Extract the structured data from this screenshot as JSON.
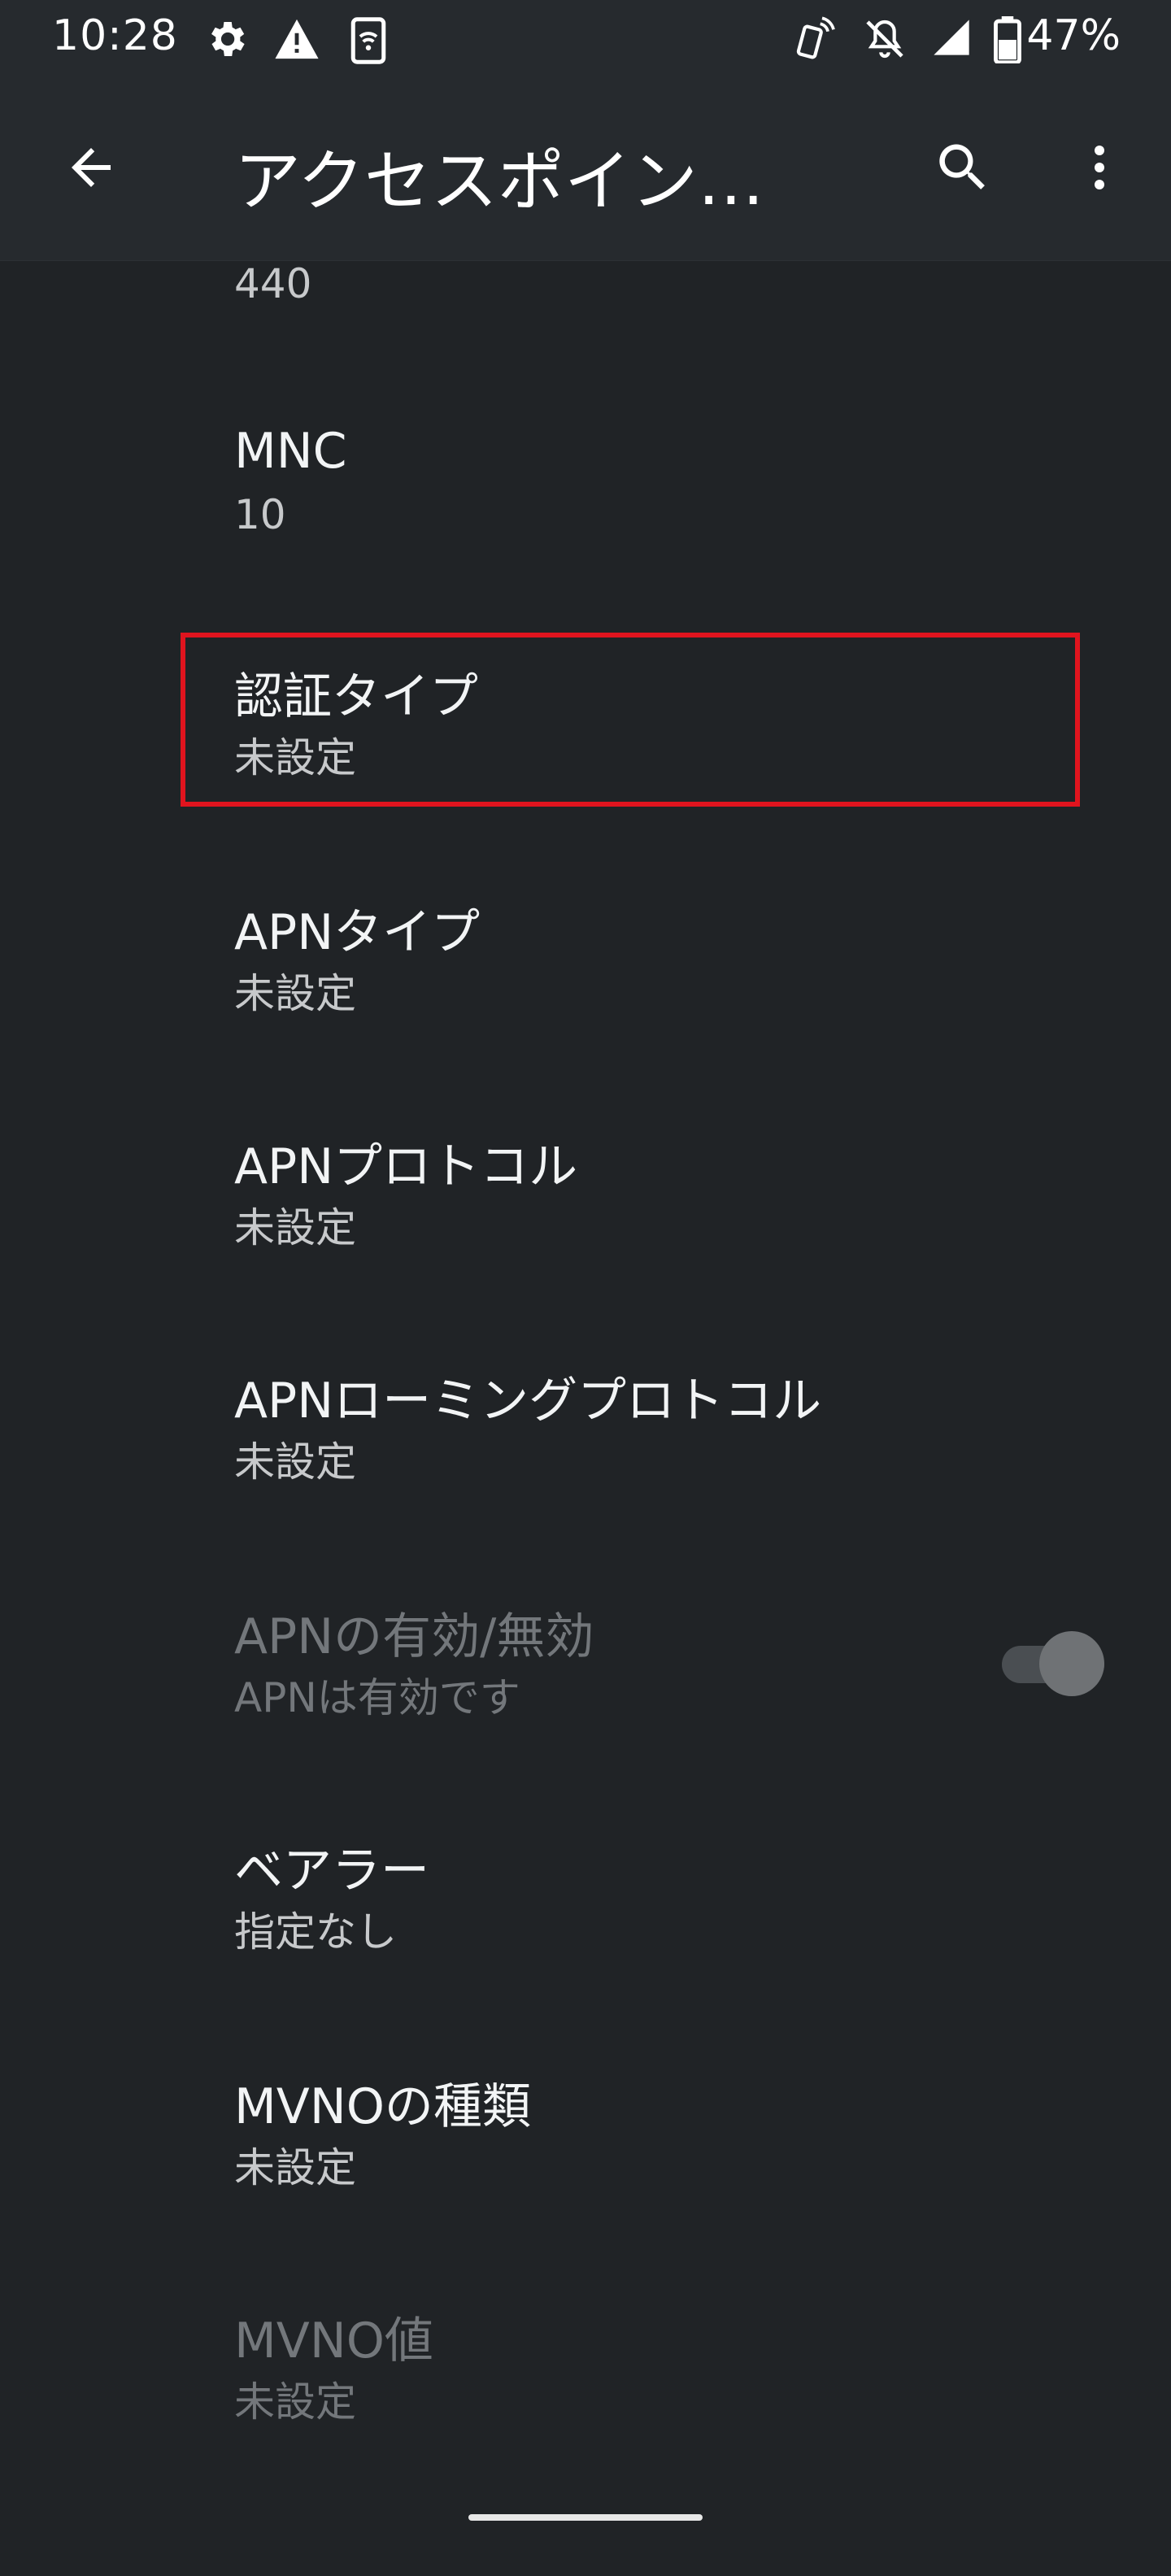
{
  "status_bar": {
    "time": "10:28",
    "icons": [
      "gear-icon",
      "warning-icon",
      "sim-wifi-icon",
      "nfc-phone-icon",
      "bell-off-icon",
      "signal-icon",
      "battery-icon"
    ],
    "battery": "47%"
  },
  "app_bar": {
    "title": "アクセスポイント…",
    "back_icon": "arrow-back-icon",
    "search_icon": "search-icon",
    "more_icon": "more-vert-icon"
  },
  "items": [
    {
      "title": "",
      "summary": "440"
    },
    {
      "title": "MNC",
      "summary": "10"
    },
    {
      "title": "認証タイプ",
      "summary": "未設定"
    },
    {
      "title": "APNタイプ",
      "summary": "未設定"
    },
    {
      "title": "APNプロトコル",
      "summary": "未設定"
    },
    {
      "title": "APNローミングプロトコル",
      "summary": "未設定"
    },
    {
      "title": "APNの有効/無効",
      "summary": "APNは有効です",
      "enabled": false,
      "switch_on": true
    },
    {
      "title": "ベアラー",
      "summary": "指定なし"
    },
    {
      "title": "MVNOの種類",
      "summary": "未設定"
    },
    {
      "title": "MVNO値",
      "summary": "未設定",
      "enabled": false
    }
  ],
  "colors": {
    "background": "#202326",
    "app_bar": "#262a2e",
    "highlight": "#e0141e"
  }
}
